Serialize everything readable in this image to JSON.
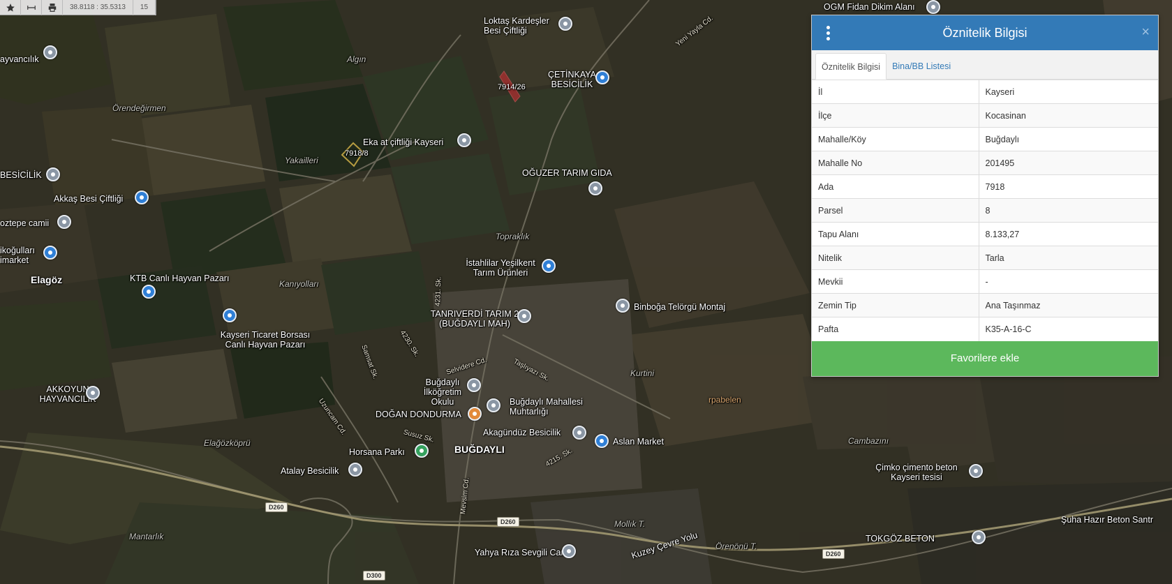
{
  "toolbar": {
    "icons": [
      "star-icon",
      "measure-icon",
      "print-icon"
    ],
    "coordinates": "38.8118 : 35.5313",
    "zoom": "15"
  },
  "panel": {
    "title": "Öznitelik Bilgisi",
    "tabs": [
      {
        "label": "Öznitelik Bilgisi",
        "active": true
      },
      {
        "label": "Bina/BB Listesi",
        "active": false
      }
    ],
    "rows": [
      {
        "key": "İl",
        "value": "Kayseri"
      },
      {
        "key": "İlçe",
        "value": "Kocasinan"
      },
      {
        "key": "Mahalle/Köy",
        "value": "Buğdaylı"
      },
      {
        "key": "Mahalle No",
        "value": "201495"
      },
      {
        "key": "Ada",
        "value": "7918"
      },
      {
        "key": "Parsel",
        "value": "8"
      },
      {
        "key": "Tapu Alanı",
        "value": "8.133,27"
      },
      {
        "key": "Nitelik",
        "value": "Tarla"
      },
      {
        "key": "Mevkii",
        "value": "-"
      },
      {
        "key": "Zemin Tip",
        "value": "Ana Taşınmaz"
      },
      {
        "key": "Pafta",
        "value": "K35-A-16-C"
      }
    ],
    "favorite_button": "Favorilere ekle",
    "close_glyph": "×"
  },
  "colors": {
    "header": "#337ab7",
    "favorite": "#5cb85c",
    "parcel_highlight": "#e0c050",
    "parcel_red": "#c23a3a"
  },
  "map": {
    "labels": [
      {
        "text": "OGM Fidan Dikim Alanı",
        "cls": ""
      },
      {
        "text": "Loktaş Kardeşler Besi Çiftliği",
        "cls": ""
      },
      {
        "text": "ÇETİNKAYA BESİCİLİK",
        "cls": ""
      },
      {
        "text": "7914/26",
        "cls": ""
      },
      {
        "text": "Algın",
        "cls": "area"
      },
      {
        "text": "Örendeğirmen",
        "cls": "area"
      },
      {
        "text": "Eka at çiftliği Kayseri",
        "cls": ""
      },
      {
        "text": "7918/8",
        "cls": ""
      },
      {
        "text": "Yakailleri",
        "cls": "area"
      },
      {
        "text": "OĞUZER TARIM GIDA",
        "cls": ""
      },
      {
        "text": "BESİCİLİK",
        "cls": ""
      },
      {
        "text": "Akkaş Besi Çiftliği",
        "cls": ""
      },
      {
        "text": "Topraklık",
        "cls": "area"
      },
      {
        "text": "İstahlilar Yeşilkent Tarım Ürünleri",
        "cls": ""
      },
      {
        "text": "Elagöz",
        "cls": "bold"
      },
      {
        "text": "KTB Canlı Hayvan Pazarı",
        "cls": ""
      },
      {
        "text": "Kanıyolları",
        "cls": "area"
      },
      {
        "text": "Binboğa Telörgü Montaj",
        "cls": ""
      },
      {
        "text": "TANRIVERDİ TARIM 2 (BUĞDAYLI MAH)",
        "cls": ""
      },
      {
        "text": "Kayseri Ticaret Borsası Canlı Hayvan Pazarı",
        "cls": ""
      },
      {
        "text": "Kurtini",
        "cls": "area"
      },
      {
        "text": "AKKOYUN HAYVANCILIK",
        "cls": ""
      },
      {
        "text": "Buğdaylı İlköğretim Okulu",
        "cls": ""
      },
      {
        "text": "Buğdaylı Mahallesi Muhtarlığı",
        "cls": ""
      },
      {
        "text": "rpabelen",
        "cls": "orange"
      },
      {
        "text": "DOĞAN DONDURMA",
        "cls": ""
      },
      {
        "text": "Akagündüz Besicilik",
        "cls": ""
      },
      {
        "text": "Aslan Market",
        "cls": ""
      },
      {
        "text": "Elağözköprü",
        "cls": "area"
      },
      {
        "text": "Horsana Parkı",
        "cls": ""
      },
      {
        "text": "BUĞDAYLI",
        "cls": "bold"
      },
      {
        "text": "Cambazını",
        "cls": "area"
      },
      {
        "text": "Atalay Besicilik",
        "cls": ""
      },
      {
        "text": "Çimko çimento beton Kayseri tesisi",
        "cls": ""
      },
      {
        "text": "Mantarlık",
        "cls": "area"
      },
      {
        "text": "Mollık T.",
        "cls": "area"
      },
      {
        "text": "Örenönü T.",
        "cls": "area"
      },
      {
        "text": "TOKGÖZ BETON",
        "cls": ""
      },
      {
        "text": "Yahya Rıza Sevgili Camii",
        "cls": ""
      },
      {
        "text": "Kuzey Çevre Yolu",
        "cls": ""
      },
      {
        "text": "Şuha Hazır Beton Santr",
        "cls": ""
      },
      {
        "text": "ayvancılık",
        "cls": ""
      },
      {
        "text": "oztepe camii",
        "cls": ""
      },
      {
        "text": "ikoğulları imarket",
        "cls": ""
      },
      {
        "text": "Uzuncam Cd.",
        "cls": "road"
      },
      {
        "text": "Mevsim Cd.",
        "cls": "road"
      },
      {
        "text": "Selvidere Cd.",
        "cls": "road"
      },
      {
        "text": "Taşlıyazı Sk.",
        "cls": "road"
      },
      {
        "text": "4231. Sk.",
        "cls": "road"
      },
      {
        "text": "4230. Sk.",
        "cls": "road"
      },
      {
        "text": "4215. Sk.",
        "cls": "road"
      },
      {
        "text": "Susuz Sk.",
        "cls": "road"
      },
      {
        "text": "Samsat Sk.",
        "cls": "road"
      },
      {
        "text": "Yeni Yayla Cd.",
        "cls": "road"
      }
    ],
    "shields": [
      "D260",
      "D260",
      "D260",
      "D300"
    ]
  }
}
